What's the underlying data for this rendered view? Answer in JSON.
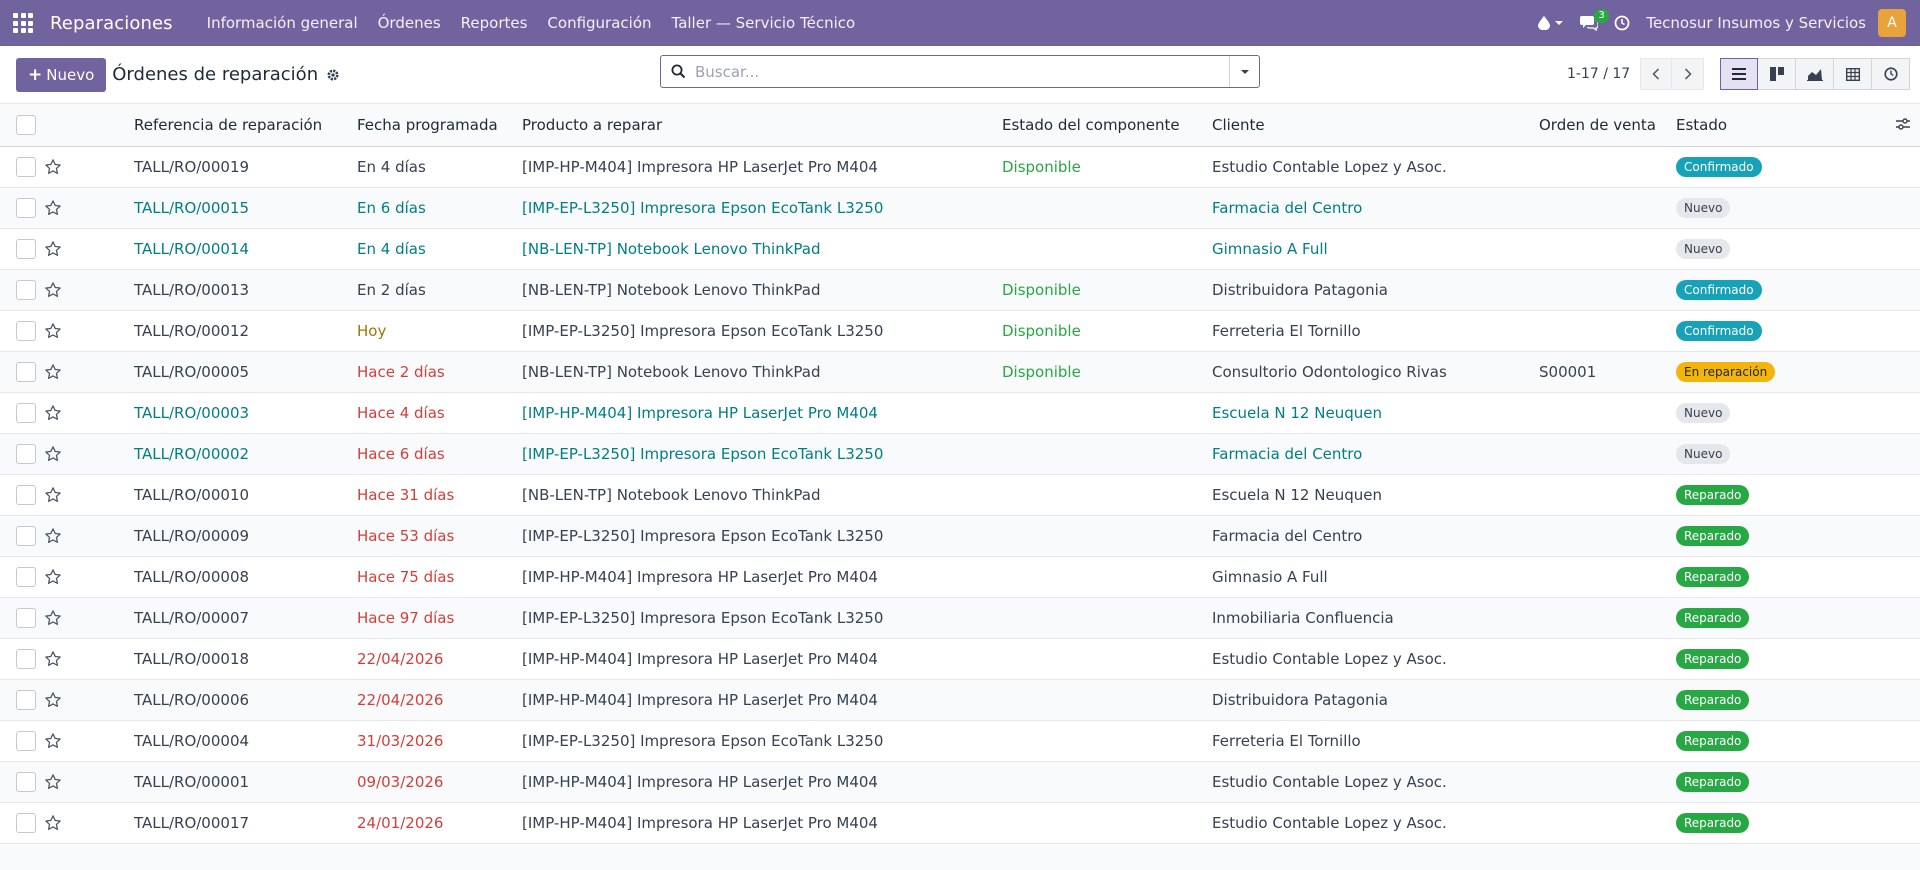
{
  "navbar": {
    "brand": "Reparaciones",
    "menu": [
      "Información general",
      "Órdenes",
      "Reportes",
      "Configuración",
      "Taller — Servicio Técnico"
    ],
    "messages_count": "3",
    "company": "Tecnosur Insumos y Servicios",
    "avatar_letter": "A"
  },
  "control": {
    "new_label": "Nuevo",
    "title": "Órdenes de reparación",
    "search_placeholder": "Buscar...",
    "pager": "1-17 / 17"
  },
  "table": {
    "headers": [
      "Referencia de reparación",
      "Fecha programada",
      "Producto a reparar",
      "Estado del componente",
      "Cliente",
      "Orden de venta",
      "Estado"
    ],
    "rows": [
      {
        "ref": "TALL/RO/00019",
        "date": "En 4 días",
        "date_style": "normal",
        "product": "[IMP-HP-M404] Impresora HP LaserJet Pro M404",
        "component": "Disponible",
        "customer": "Estudio Contable Lopez y Asoc.",
        "sale": "",
        "status": "Confirmado",
        "status_key": "confirmado",
        "linked": false
      },
      {
        "ref": "TALL/RO/00015",
        "date": "En 6 días",
        "date_style": "link",
        "product": "[IMP-EP-L3250] Impresora Epson EcoTank L3250",
        "component": "",
        "customer": "Farmacia del Centro",
        "sale": "",
        "status": "Nuevo",
        "status_key": "nuevo",
        "linked": true
      },
      {
        "ref": "TALL/RO/00014",
        "date": "En 4 días",
        "date_style": "link",
        "product": "[NB-LEN-TP] Notebook Lenovo ThinkPad",
        "component": "",
        "customer": "Gimnasio A Full",
        "sale": "",
        "status": "Nuevo",
        "status_key": "nuevo",
        "linked": true
      },
      {
        "ref": "TALL/RO/00013",
        "date": "En 2 días",
        "date_style": "normal",
        "product": "[NB-LEN-TP] Notebook Lenovo ThinkPad",
        "component": "Disponible",
        "customer": "Distribuidora Patagonia",
        "sale": "",
        "status": "Confirmado",
        "status_key": "confirmado",
        "linked": false
      },
      {
        "ref": "TALL/RO/00012",
        "date": "Hoy",
        "date_style": "warn",
        "product": "[IMP-EP-L3250] Impresora Epson EcoTank L3250",
        "component": "Disponible",
        "customer": "Ferreteria El Tornillo",
        "sale": "",
        "status": "Confirmado",
        "status_key": "confirmado",
        "linked": false
      },
      {
        "ref": "TALL/RO/00005",
        "date": "Hace 2 días",
        "date_style": "late",
        "product": "[NB-LEN-TP] Notebook Lenovo ThinkPad",
        "component": "Disponible",
        "customer": "Consultorio Odontologico Rivas",
        "sale": "S00001",
        "status": "En reparación",
        "status_key": "reparacion",
        "linked": false
      },
      {
        "ref": "TALL/RO/00003",
        "date": "Hace 4 días",
        "date_style": "late",
        "product": "[IMP-HP-M404] Impresora HP LaserJet Pro M404",
        "component": "",
        "customer": "Escuela N 12 Neuquen",
        "sale": "",
        "status": "Nuevo",
        "status_key": "nuevo",
        "linked": true
      },
      {
        "ref": "TALL/RO/00002",
        "date": "Hace 6 días",
        "date_style": "late",
        "product": "[IMP-EP-L3250] Impresora Epson EcoTank L3250",
        "component": "",
        "customer": "Farmacia del Centro",
        "sale": "",
        "status": "Nuevo",
        "status_key": "nuevo",
        "linked": true
      },
      {
        "ref": "TALL/RO/00010",
        "date": "Hace 31 días",
        "date_style": "late",
        "product": "[NB-LEN-TP] Notebook Lenovo ThinkPad",
        "component": "",
        "customer": "Escuela N 12 Neuquen",
        "sale": "",
        "status": "Reparado",
        "status_key": "reparado",
        "linked": false
      },
      {
        "ref": "TALL/RO/00009",
        "date": "Hace 53 días",
        "date_style": "late",
        "product": "[IMP-EP-L3250] Impresora Epson EcoTank L3250",
        "component": "",
        "customer": "Farmacia del Centro",
        "sale": "",
        "status": "Reparado",
        "status_key": "reparado",
        "linked": false
      },
      {
        "ref": "TALL/RO/00008",
        "date": "Hace 75 días",
        "date_style": "late",
        "product": "[IMP-HP-M404] Impresora HP LaserJet Pro M404",
        "component": "",
        "customer": "Gimnasio A Full",
        "sale": "",
        "status": "Reparado",
        "status_key": "reparado",
        "linked": false
      },
      {
        "ref": "TALL/RO/00007",
        "date": "Hace 97 días",
        "date_style": "late",
        "product": "[IMP-EP-L3250] Impresora Epson EcoTank L3250",
        "component": "",
        "customer": "Inmobiliaria Confluencia",
        "sale": "",
        "status": "Reparado",
        "status_key": "reparado",
        "linked": false
      },
      {
        "ref": "TALL/RO/00018",
        "date": "22/04/2026",
        "date_style": "late",
        "product": "[IMP-HP-M404] Impresora HP LaserJet Pro M404",
        "component": "",
        "customer": "Estudio Contable Lopez y Asoc.",
        "sale": "",
        "status": "Reparado",
        "status_key": "reparado",
        "linked": false
      },
      {
        "ref": "TALL/RO/00006",
        "date": "22/04/2026",
        "date_style": "late",
        "product": "[IMP-HP-M404] Impresora HP LaserJet Pro M404",
        "component": "",
        "customer": "Distribuidora Patagonia",
        "sale": "",
        "status": "Reparado",
        "status_key": "reparado",
        "linked": false
      },
      {
        "ref": "TALL/RO/00004",
        "date": "31/03/2026",
        "date_style": "late",
        "product": "[IMP-EP-L3250] Impresora Epson EcoTank L3250",
        "component": "",
        "customer": "Ferreteria El Tornillo",
        "sale": "",
        "status": "Reparado",
        "status_key": "reparado",
        "linked": false
      },
      {
        "ref": "TALL/RO/00001",
        "date": "09/03/2026",
        "date_style": "late",
        "product": "[IMP-HP-M404] Impresora HP LaserJet Pro M404",
        "component": "",
        "customer": "Estudio Contable Lopez y Asoc.",
        "sale": "",
        "status": "Reparado",
        "status_key": "reparado",
        "linked": false
      },
      {
        "ref": "TALL/RO/00017",
        "date": "24/01/2026",
        "date_style": "late",
        "product": "[IMP-HP-M404] Impresora HP LaserJet Pro M404",
        "component": "",
        "customer": "Estudio Contable Lopez y Asoc.",
        "sale": "",
        "status": "Reparado",
        "status_key": "reparado",
        "linked": false
      }
    ]
  },
  "colors": {
    "brand": "#71639e",
    "link": "#017e84",
    "late": "#d23f3a",
    "available": "#28a745"
  }
}
